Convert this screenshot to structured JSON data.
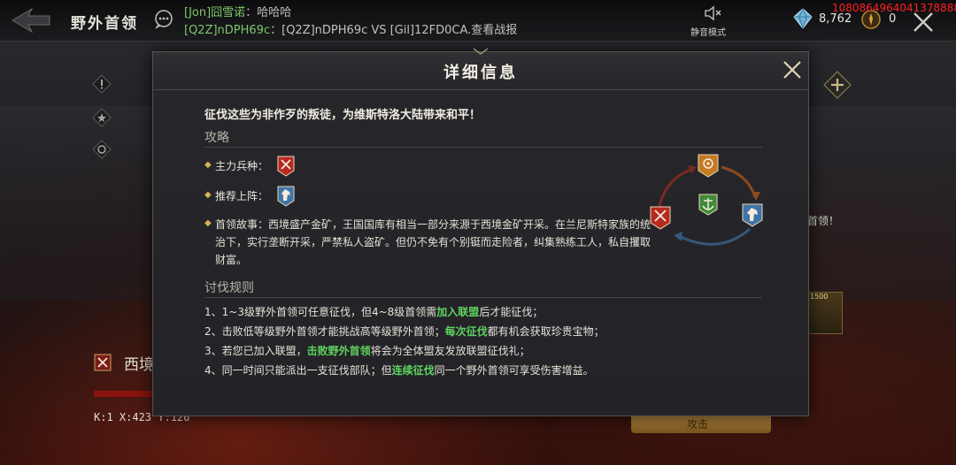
{
  "topbar": {
    "title": "野外首领",
    "chat": [
      {
        "sender": "[Jon]囧雪诺",
        "sep": "：",
        "message": "哈哈哈"
      },
      {
        "sender": "[Q2Z]nDPH69c",
        "sep": "：",
        "message": "[Q2Z]nDPH69c VS [Gil]12FD0CA.查看战报"
      }
    ],
    "mute_label": "静音模式",
    "gems": "8,762",
    "gold": "0",
    "overlay_id": "1080864964041378888"
  },
  "background": {
    "right_hint": "首领！",
    "reward_count": "1500",
    "boss_name": "西境",
    "coords": "K:1 X:423 Y:126",
    "attack_label": "攻击"
  },
  "modal": {
    "title": "详细信息",
    "intro": "征伐这些为非作歹的叛徒，为维斯特洛大陆带来和平！",
    "strategy_title": "攻略",
    "main_unit_label": "主力兵种：",
    "recommend_label": "推荐上阵：",
    "story_label": "首领故事：",
    "story_text": "西境盛产金矿，王国国库有相当一部分来源于西境金矿开采。在兰尼斯特家族的统治下，实行垄断开采，严禁私人盗矿。但仍不免有个别铤而走险者，纠集熟练工人，私自攫取财富。",
    "rules_title": "讨伐规则",
    "rules": [
      {
        "pre": "1、1~3级野外首领可任意征伐，但4~8级首领需",
        "hl": "加入联盟",
        "post": "后才能征伐；"
      },
      {
        "pre": "2、击败低等级野外首领才能挑战高等级野外首领；",
        "hl": "每次征伐",
        "post": "都有机会获取珍贵宝物；"
      },
      {
        "pre": "3、若您已加入联盟，",
        "hl": "击败野外首领",
        "post": "将会为全体盟友发放联盟征伐礼；"
      },
      {
        "pre": "4、同一时间只能派出一支征伐部队；但",
        "hl": "连续征伐",
        "post": "同一个野外首领可享受伤害增益。"
      }
    ]
  },
  "colors": {
    "highlight": "#5fd25f",
    "infantry_red": "#b62a22",
    "cavalry_blue": "#3f74a8",
    "archer_orange": "#c57a24",
    "center_green": "#3e8a3a",
    "gold_bullet": "#d8b058"
  },
  "icons": [
    "back-arrow-icon",
    "chat-icon",
    "mute-icon",
    "gem-icon",
    "gold-icon",
    "close-icon",
    "crossed-swords-icon",
    "horse-head-icon",
    "archery-target-icon",
    "anchor-icon"
  ]
}
